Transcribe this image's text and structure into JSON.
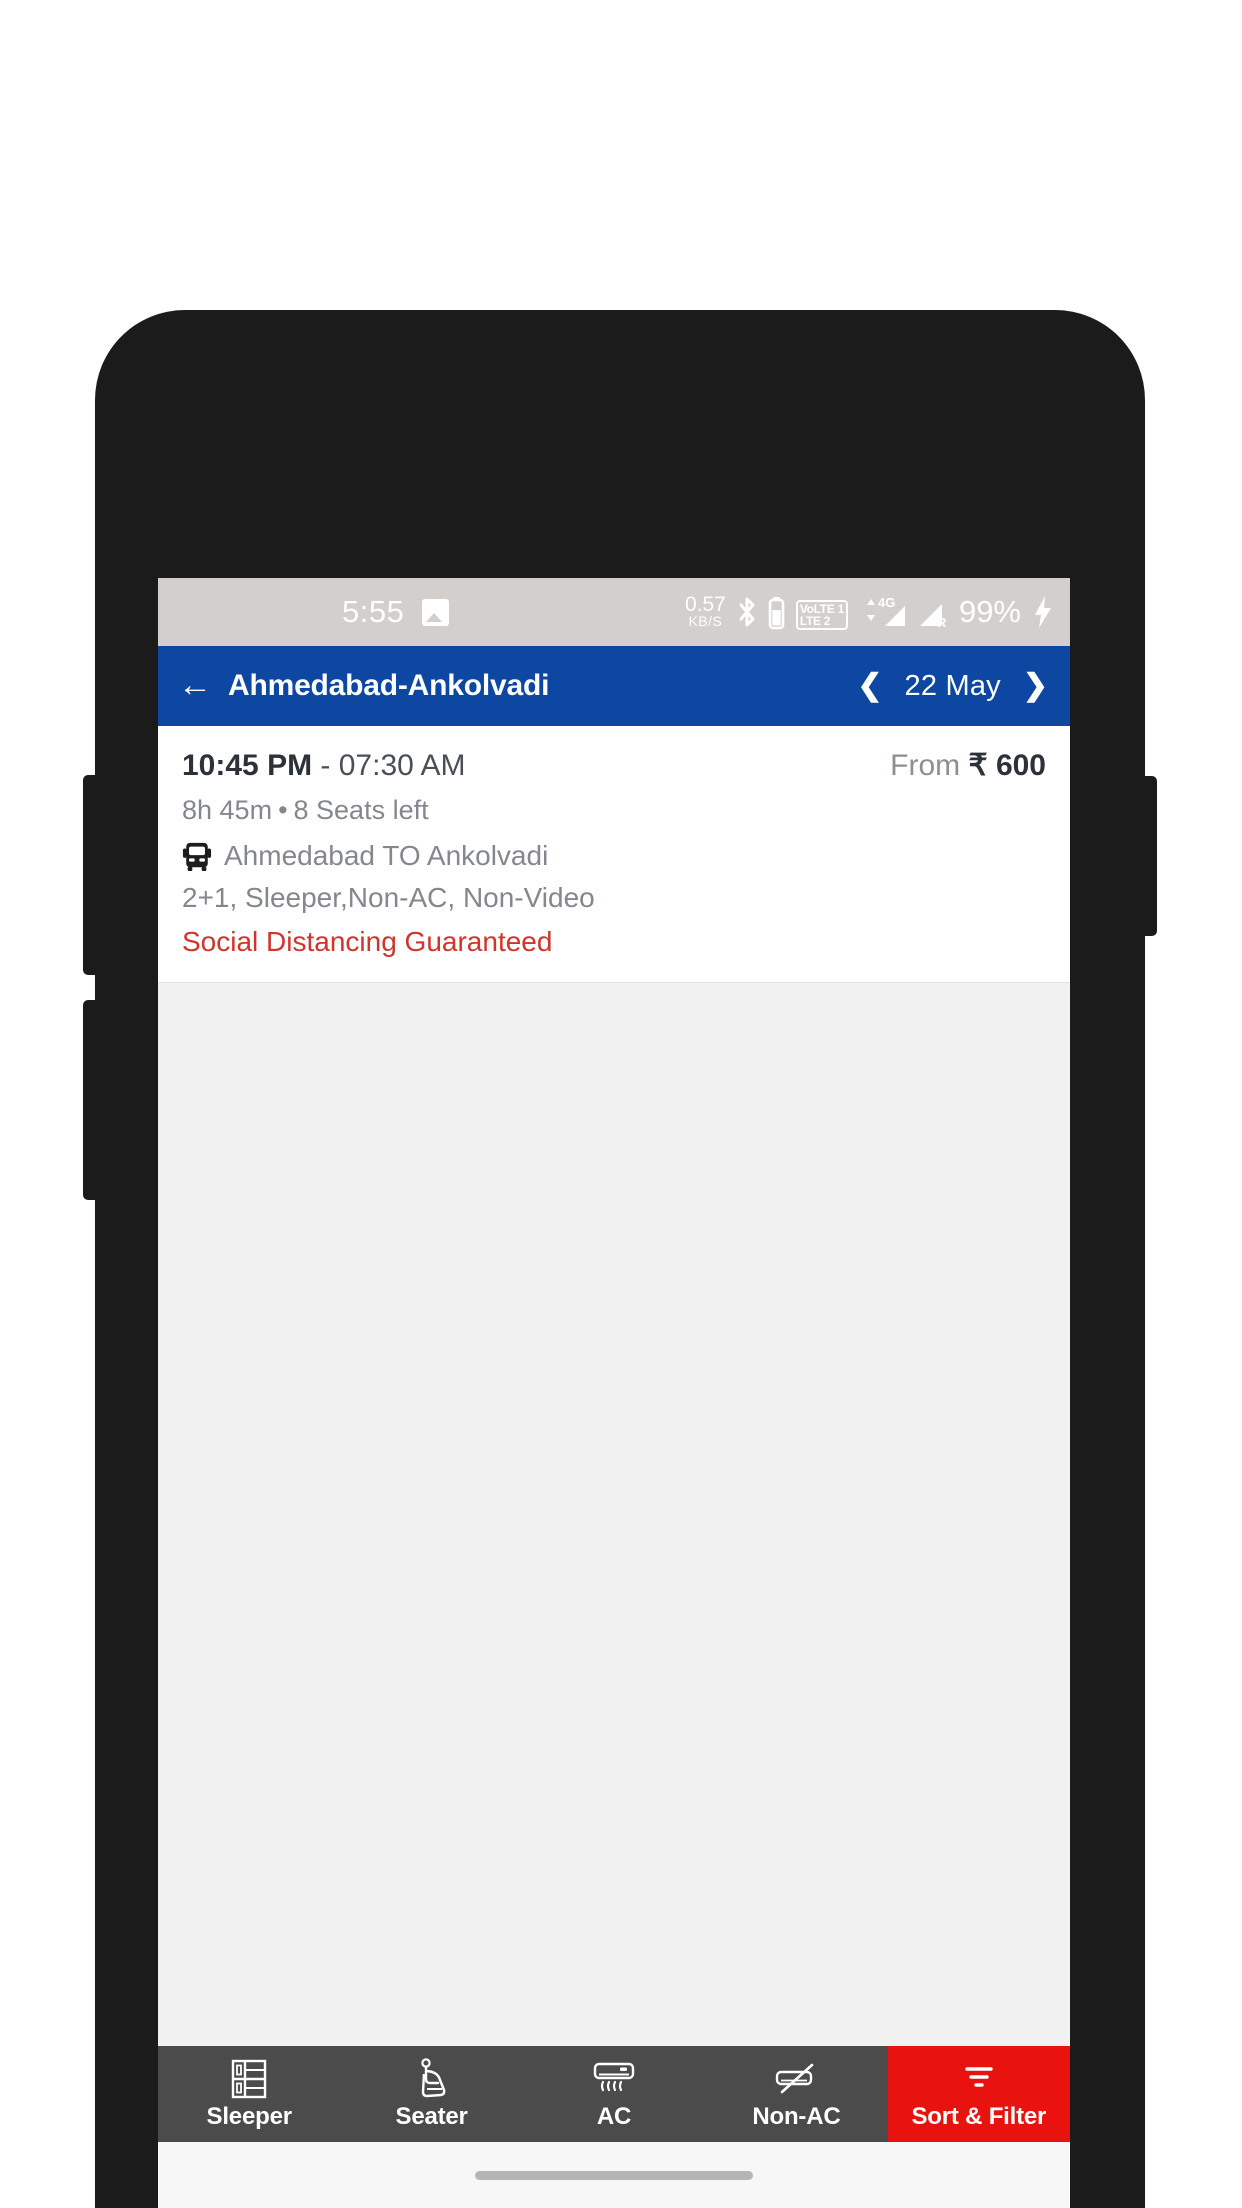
{
  "status_bar": {
    "time": "5:55",
    "screenshot_icon": "image-icon",
    "network_speed_value": "0.57",
    "network_speed_unit": "KB/S",
    "bluetooth_icon": "bluetooth-icon",
    "bluetooth_battery_icon": "bluetooth-device-battery-icon",
    "volte_sim1": "VoLTE 1",
    "volte_sim2": "LTE 2",
    "data_type": "4G",
    "signal_sim1_icon": "signal-bars-icon",
    "signal_sim2_icon": "signal-bars-roaming-icon",
    "roaming_label": "R",
    "battery_percent": "99%",
    "charging_icon": "charging-bolt-icon",
    "bg_color": "#d2cfcd"
  },
  "appbar": {
    "back_icon": "back-arrow-icon",
    "title": "Ahmedabad-Ankolvadi",
    "prev_icon": "chevron-left-icon",
    "date": "22 May",
    "next_icon": "chevron-right-icon",
    "bg_color": "#0d47a1"
  },
  "results": {
    "buses": [
      {
        "departure_time": "10:45 PM",
        "time_separator": " - ",
        "arrival_time": "07:30 AM",
        "fare_prefix": "From",
        "fare_amount": "₹ 600",
        "duration": "8h 45m",
        "bullet": "•",
        "seats_left": "8 Seats left",
        "bus_icon": "bus-front-icon",
        "route": "Ahmedabad TO Ankolvadi",
        "bus_type": "2+1, Sleeper,Non-AC, Non-Video",
        "badge": "Social Distancing Guaranteed",
        "badge_color": "#d0342c"
      }
    ]
  },
  "bottom_bar": {
    "items": [
      {
        "label": "Sleeper",
        "icon": "sleeper-berth-icon",
        "active": false
      },
      {
        "label": "Seater",
        "icon": "seat-icon",
        "active": false
      },
      {
        "label": "AC",
        "icon": "air-conditioner-icon",
        "active": false
      },
      {
        "label": "Non-AC",
        "icon": "no-air-conditioner-icon",
        "active": false
      },
      {
        "label": "Sort & Filter",
        "icon": "filter-icon",
        "active": true
      }
    ],
    "bg_color": "#4b4b4b",
    "accent_color": "#e8130f"
  },
  "gesture_bar": {
    "indicator": "home-indicator"
  }
}
